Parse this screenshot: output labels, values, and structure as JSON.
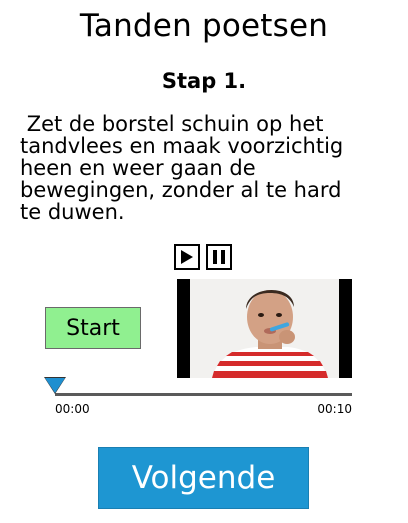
{
  "header": {
    "title": "Tanden poetsen",
    "step": "Stap 1."
  },
  "instruction": {
    "text": " Zet de borstel schuin op het\ntandvlees en maak voorzichtig\nheen en weer gaan de\nbewegingen, zonder al te hard\nte duwen."
  },
  "media": {
    "play_icon": "play-icon",
    "pause_icon": "pause-icon",
    "start_label": "Start",
    "progress": 0,
    "time_start": "00:00",
    "time_end": "00:10"
  },
  "footer": {
    "next_label": "Volgende"
  },
  "colors": {
    "start_button": "#90f090",
    "next_button": "#1e96d2",
    "playhead": "#1e8fd0"
  }
}
